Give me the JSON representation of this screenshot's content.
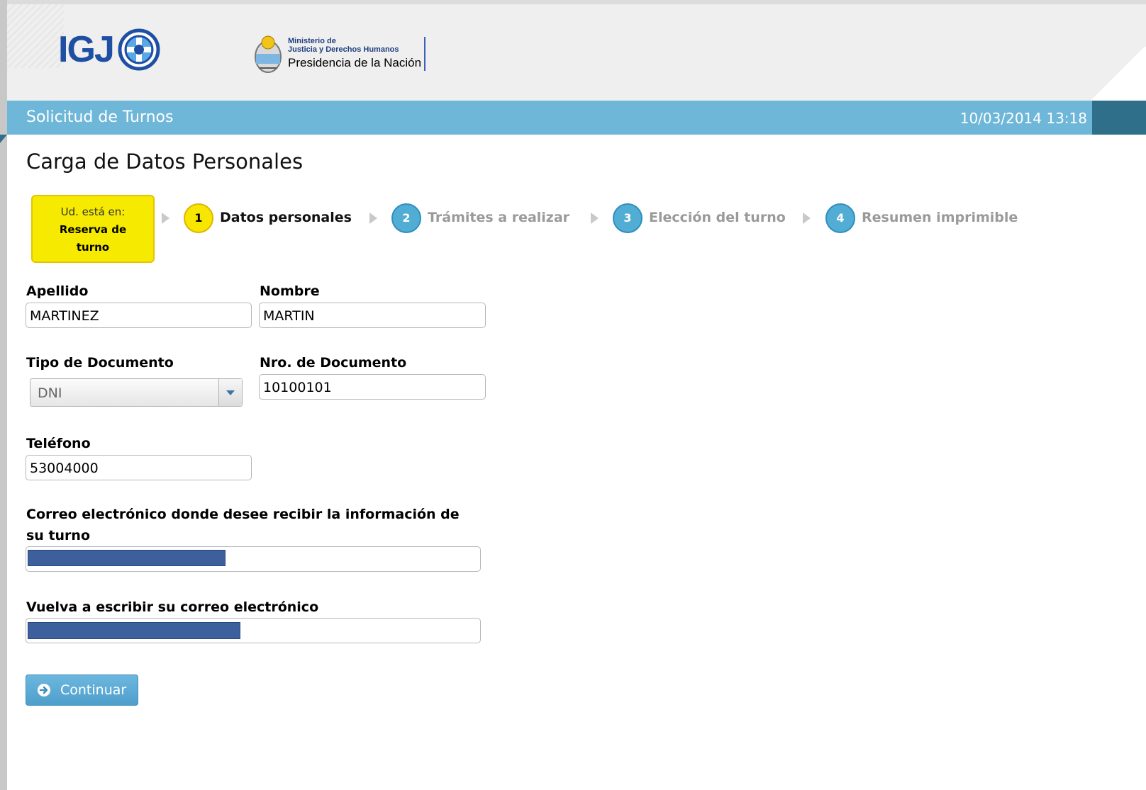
{
  "header": {
    "logo_text": "IGJ",
    "ministry_line1": "Ministerio de",
    "ministry_line2": "Justicia y Derechos Humanos",
    "ministry_line3": "Presidencia de la Nación"
  },
  "bar": {
    "title": "Solicitud de Turnos",
    "datetime": "10/03/2014 13:18"
  },
  "page_title": "Carga de Datos Personales",
  "you_are_here": {
    "line1": "Ud. está en:",
    "line2": "Reserva de",
    "line3": "turno"
  },
  "steps": [
    {
      "number": "1",
      "label": "Datos personales",
      "state": "active"
    },
    {
      "number": "2",
      "label": "Trámites a realizar",
      "state": "todo"
    },
    {
      "number": "3",
      "label": "Elección del turno",
      "state": "todo"
    },
    {
      "number": "4",
      "label": "Resumen imprimible",
      "state": "todo"
    }
  ],
  "form": {
    "apellido_label": "Apellido",
    "apellido_value": "MARTINEZ",
    "nombre_label": "Nombre",
    "nombre_value": "MARTIN",
    "tipo_doc_label": "Tipo de Documento",
    "tipo_doc_value": "DNI",
    "nro_doc_label": "Nro. de Documento",
    "nro_doc_value": "10100101",
    "telefono_label": "Teléfono",
    "telefono_value": "53004000",
    "email_label_line1": "Correo electrónico donde desee recibir la información de",
    "email_label_line2": "su turno",
    "email_confirm_label": "Vuelva a escribir su correo electrónico"
  },
  "continue_label": "Continuar",
  "colors": {
    "bar": "#6fb7d8",
    "highlight": "#f5ea00",
    "step_todo": "#52add4",
    "button": "#5aa9d4",
    "redaction": "#3d5f9c"
  }
}
